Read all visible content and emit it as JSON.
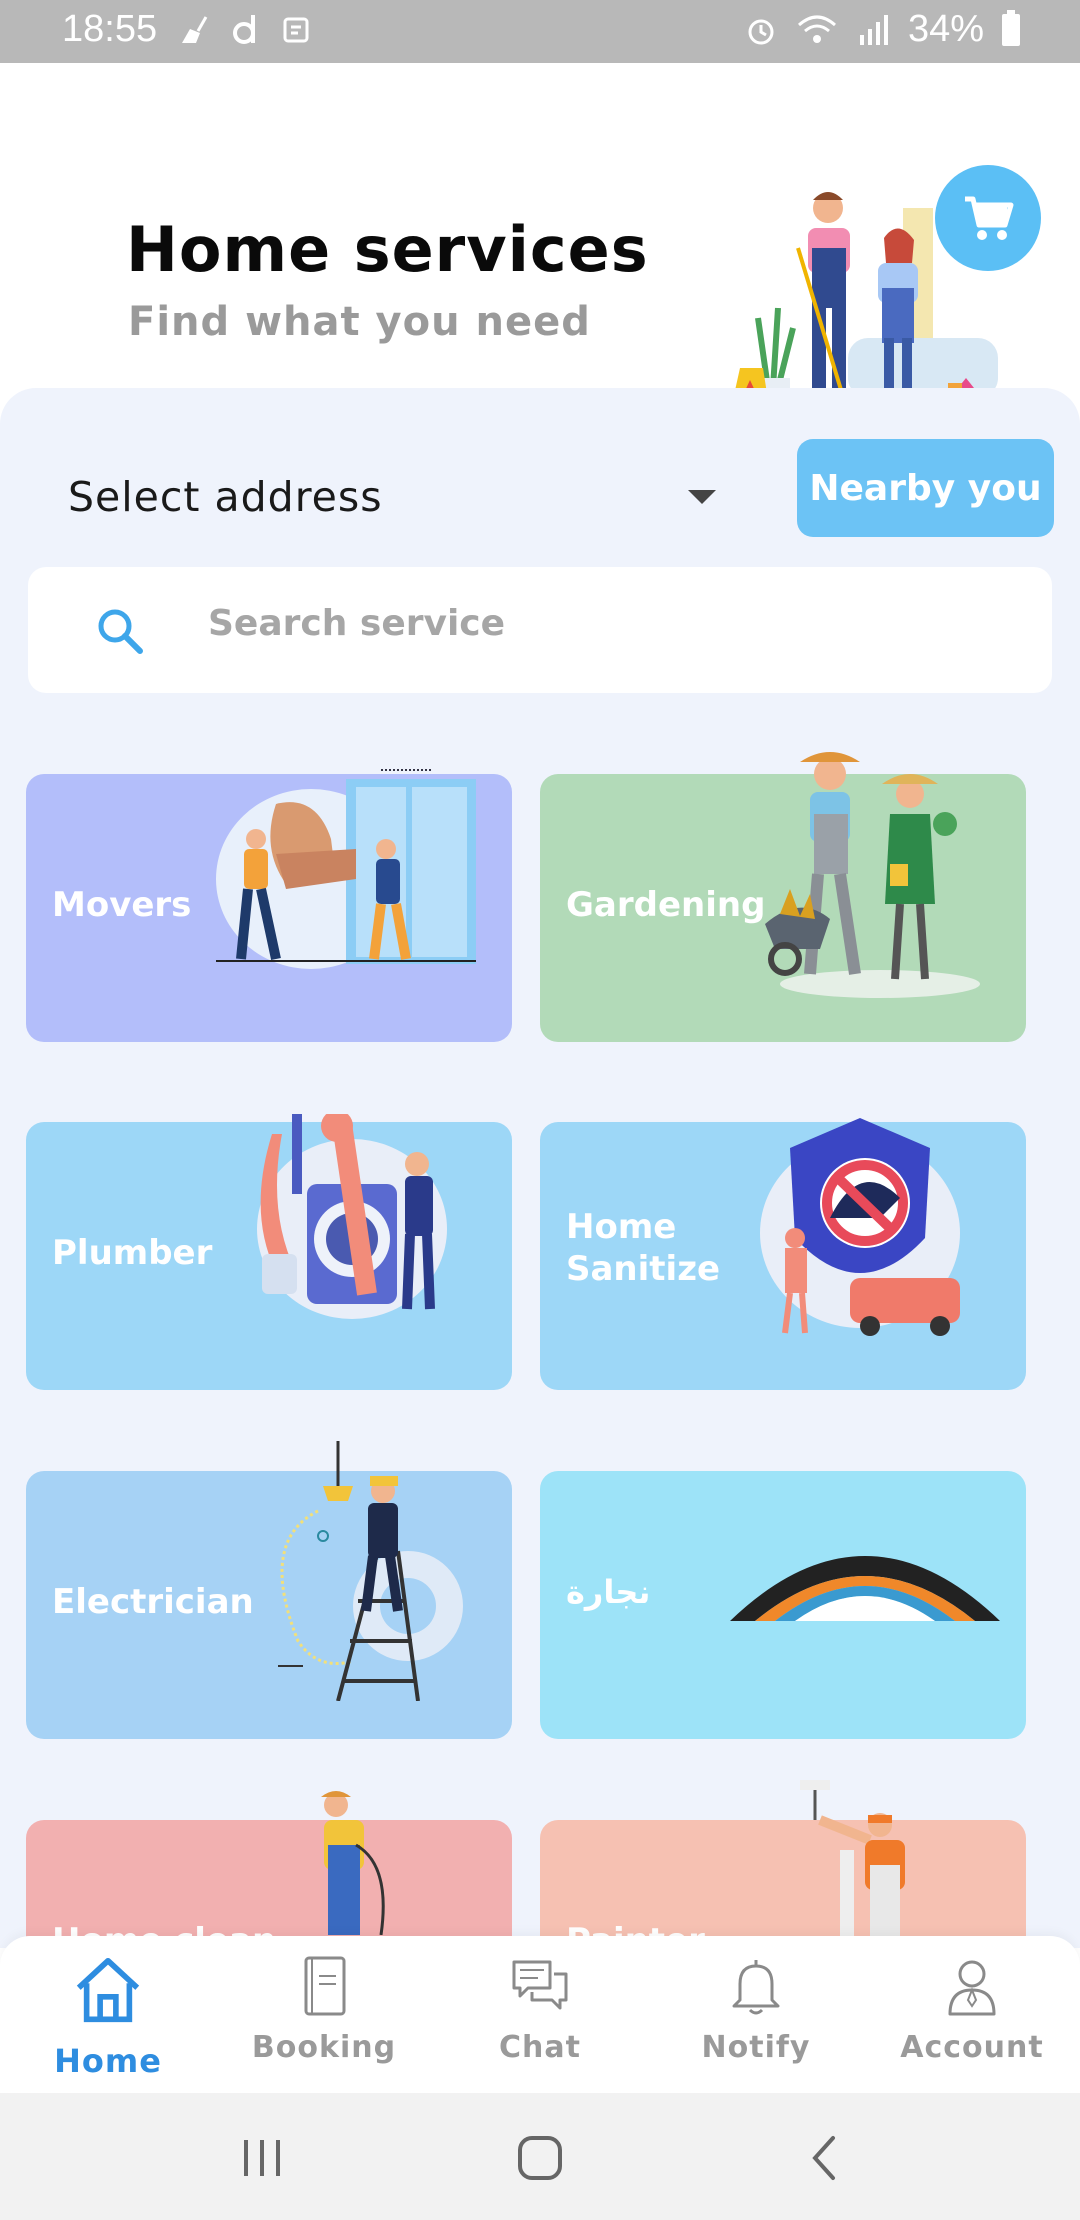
{
  "status_bar": {
    "time": "18:55",
    "battery": "34%"
  },
  "header": {
    "title": "Home services",
    "subtitle": "Find what you need",
    "cart_icon": "cart-icon"
  },
  "address": {
    "label": "Select address",
    "nearby_label": "Nearby you"
  },
  "search": {
    "placeholder": "Search service"
  },
  "categories": [
    {
      "label": "Movers",
      "color": "#b3befa"
    },
    {
      "label": "Gardening",
      "color": "#b2dab8"
    },
    {
      "label": "Plumber",
      "color": "#9dd7f7"
    },
    {
      "label": "Home Sanitize",
      "color": "#9dd7f7"
    },
    {
      "label": "Electrician",
      "color": "#a6d2f5"
    },
    {
      "label": "نجارة",
      "color": "#9de3f8"
    },
    {
      "label": "Home clean",
      "color": "#f2b0b0"
    },
    {
      "label": "Painter",
      "color": "#f6c1b2"
    }
  ],
  "bottom_nav": [
    {
      "label": "Home",
      "icon": "home-icon",
      "active": true
    },
    {
      "label": "Booking",
      "icon": "booking-icon",
      "active": false
    },
    {
      "label": "Chat",
      "icon": "chat-icon",
      "active": false
    },
    {
      "label": "Notify",
      "icon": "bell-icon",
      "active": false
    },
    {
      "label": "Account",
      "icon": "account-icon",
      "active": false
    }
  ],
  "colors": {
    "accent": "#5bbff5",
    "active_nav": "#2e8de0",
    "panel_bg": "#eff3fc"
  }
}
